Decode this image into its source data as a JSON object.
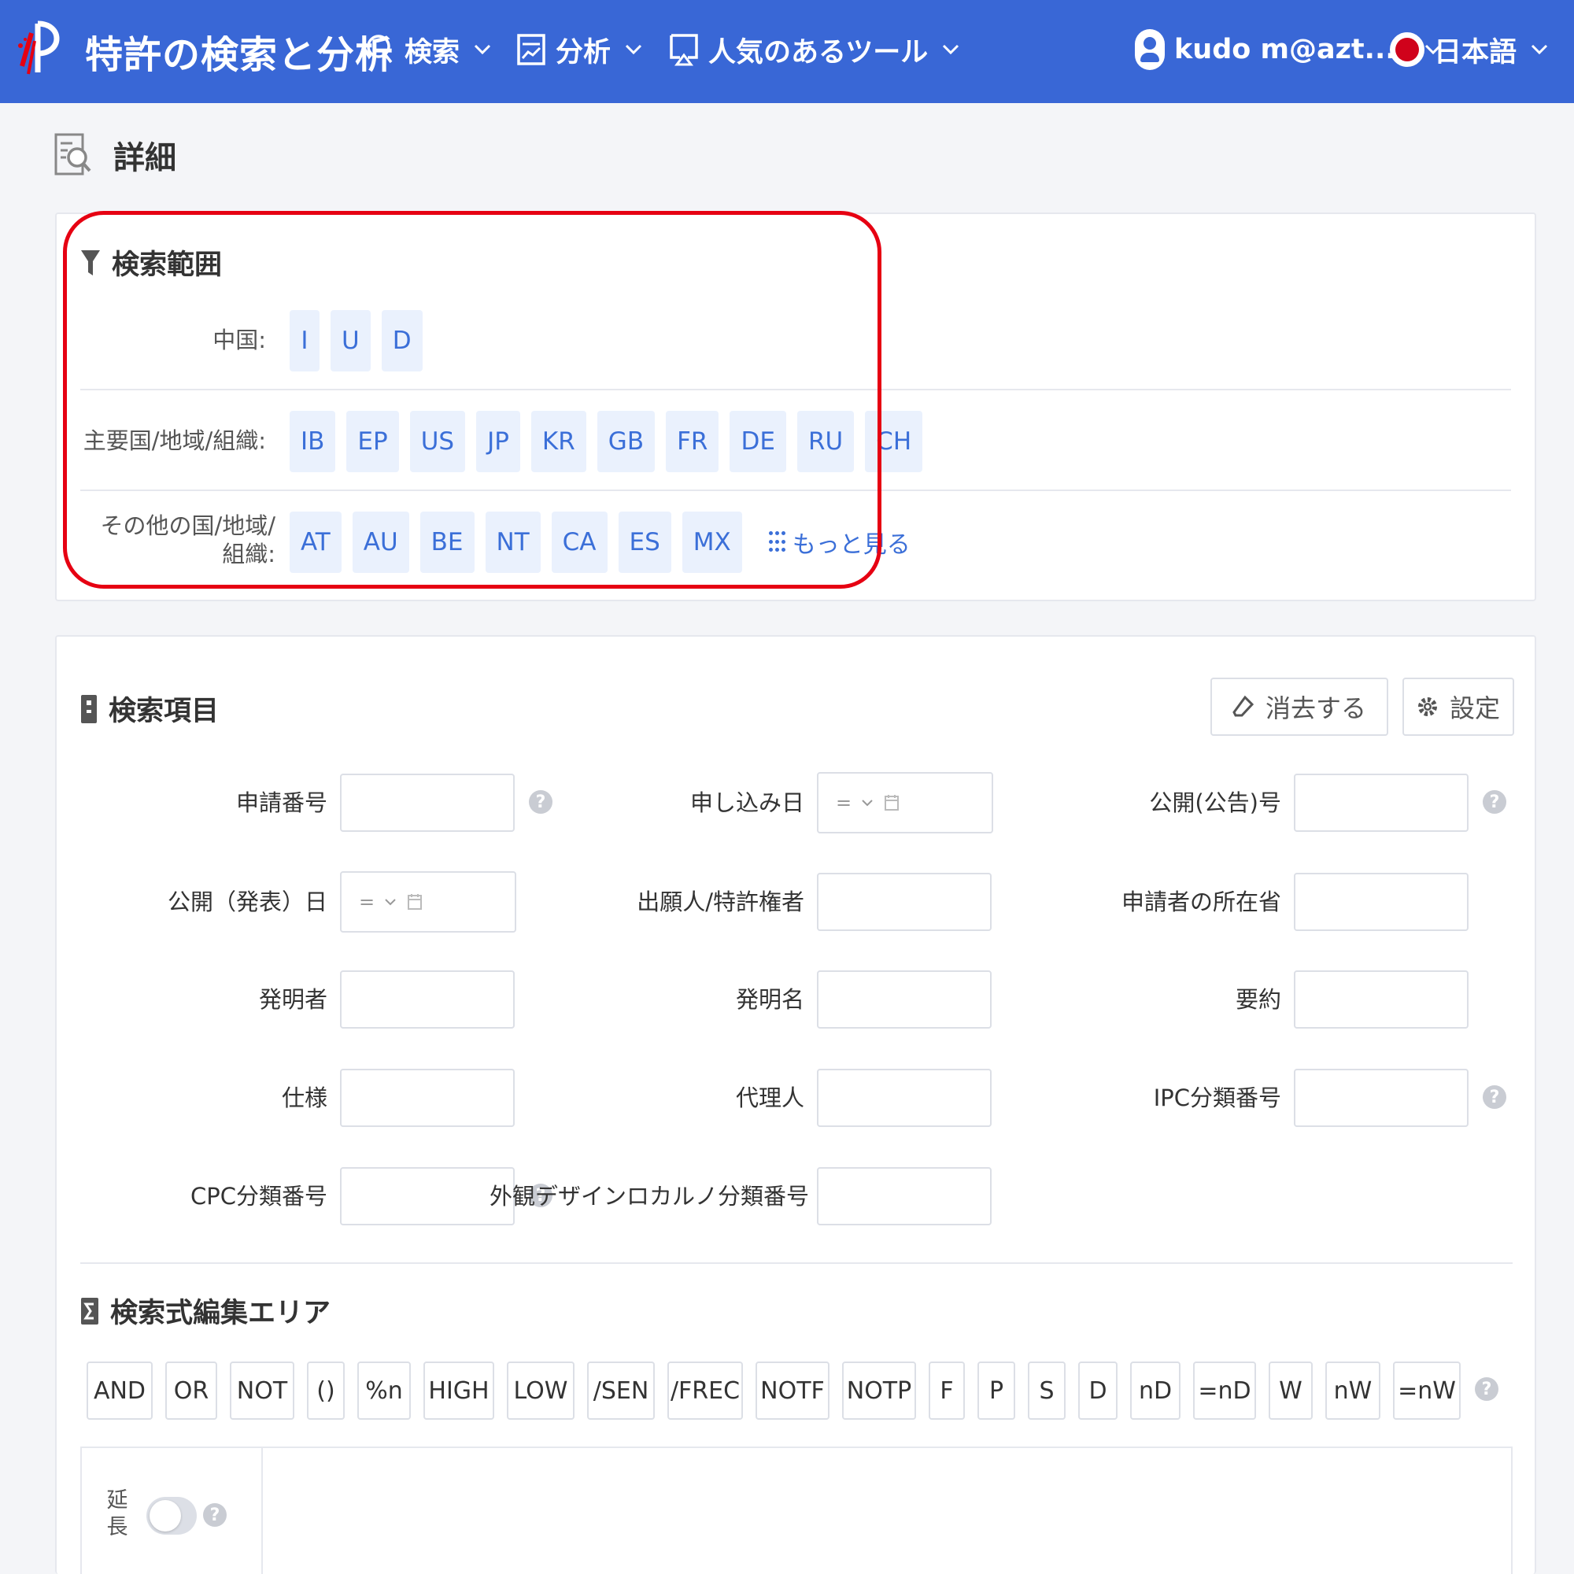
{
  "header": {
    "brand": "特許の検索と分析",
    "nav": [
      {
        "label": "検索",
        "icon": "search-icon"
      },
      {
        "label": "分析",
        "icon": "chart-icon"
      },
      {
        "label": "人気のあるツール",
        "icon": "tools-icon"
      }
    ],
    "user": "kudo m@azt...",
    "language": "日本語",
    "accent": "#3967d6"
  },
  "page": {
    "title": "詳細"
  },
  "scope": {
    "title": "検索範囲",
    "rows": [
      {
        "label": "中国:",
        "chips": [
          "I",
          "U",
          "D"
        ]
      },
      {
        "label": "主要国/地域/組織:",
        "chips": [
          "IB",
          "EP",
          "US",
          "JP",
          "KR",
          "GB",
          "FR",
          "DE",
          "RU",
          "CH"
        ]
      },
      {
        "label": "その他の国/地域/組織:",
        "chips": [
          "AT",
          "AU",
          "BE",
          "NT",
          "CA",
          "ES",
          "MX"
        ]
      }
    ],
    "more": "もっと見る",
    "highlight_color": "#e60012"
  },
  "items": {
    "title": "検索項目",
    "clear_label": "消去する",
    "settings_label": "設定",
    "fields": {
      "app_number": "申請番号",
      "app_date": "申し込み日",
      "pub_number": "公開(公告)号",
      "pub_date": "公開（発表）日",
      "applicant": "出願人/特許権者",
      "applicant_region": "申請者の所在省",
      "inventor": "発明者",
      "invention_name": "発明名",
      "abstract": "要約",
      "spec": "仕様",
      "agent": "代理人",
      "ipc": "IPC分類番号",
      "cpc": "CPC分類番号",
      "locarno": "外観デザインロカルノ分類番号"
    },
    "date_operator": "="
  },
  "editor": {
    "title": "検索式編集エリア",
    "operators": [
      "AND",
      "OR",
      "NOT",
      "()",
      "%n",
      "HIGH",
      "LOW",
      "/SEN",
      "/FREC",
      "NOTF",
      "NOTP",
      "F",
      "P",
      "S",
      "D",
      "nD",
      "=nD",
      "W",
      "nW",
      "=nW"
    ],
    "extend_label": "延長"
  }
}
